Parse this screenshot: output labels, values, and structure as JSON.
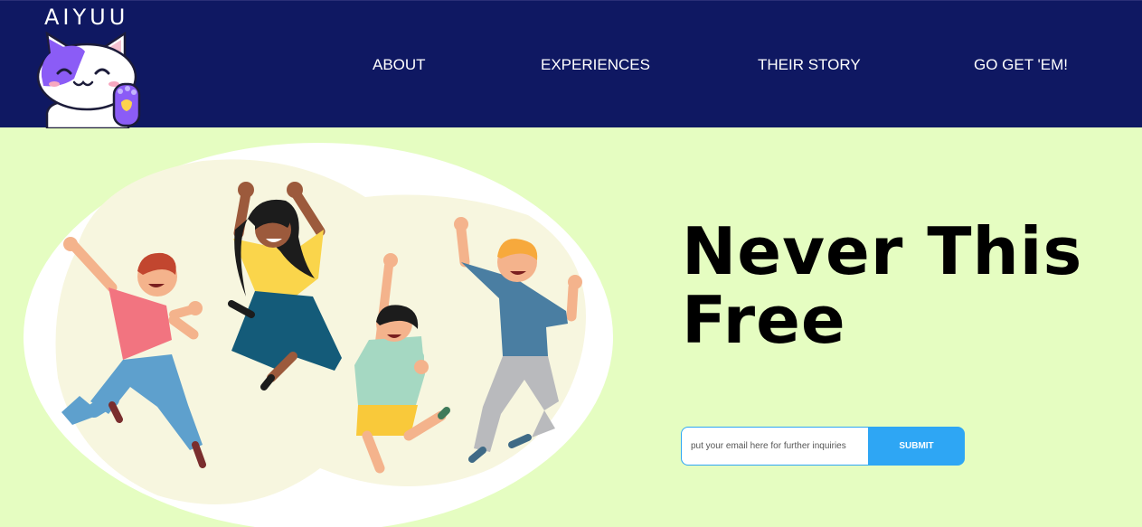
{
  "brand": {
    "name": "AIYUU",
    "logo_icon": "cat-waving-icon"
  },
  "nav": {
    "items": [
      {
        "label": "ABOUT"
      },
      {
        "label": "EXPERIENCES"
      },
      {
        "label": "THEIR STORY"
      },
      {
        "label": "GO GET 'EM!"
      }
    ]
  },
  "hero": {
    "headline": "Never This Free",
    "illustration_icon": "jumping-people-illustration"
  },
  "signup": {
    "email_placeholder": "put your email here for further inquiries",
    "submit_label": "SUBMIT"
  },
  "colors": {
    "navbar": "#0f1862",
    "page_background": "#e5fdc1",
    "accent": "#2ea6f4"
  }
}
